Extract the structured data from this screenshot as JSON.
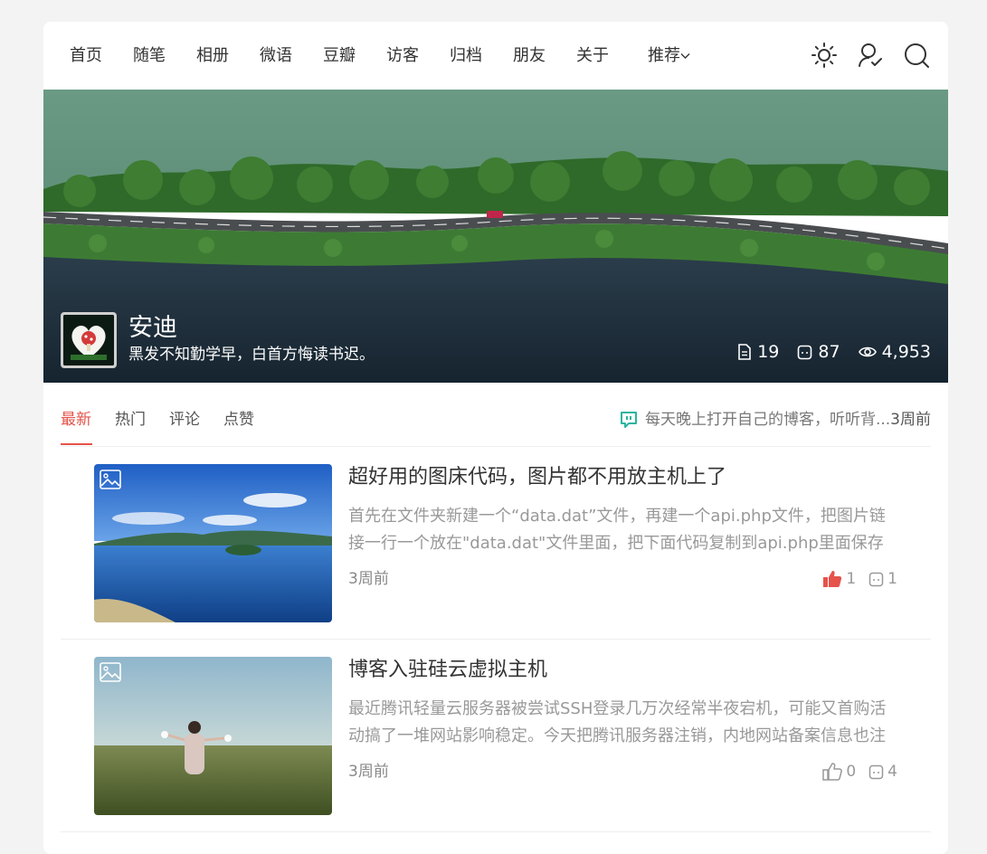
{
  "nav": {
    "items": [
      "首页",
      "随笔",
      "相册",
      "微语",
      "豆瓣",
      "访客",
      "归档",
      "朋友",
      "关于"
    ],
    "recommend_label": "推荐",
    "icons": [
      "sun-icon",
      "user-icon",
      "search-icon"
    ]
  },
  "hero": {
    "site_name": "安迪",
    "motto": "黑发不知勤学早，白首方悔读书迟。",
    "stats": {
      "posts": "19",
      "comments": "87",
      "views": "4,953"
    }
  },
  "tabs": {
    "items": [
      "最新",
      "热门",
      "评论",
      "点赞"
    ],
    "active": "最新",
    "notice_text": "每天晚上打开自己的博客，听听背...",
    "notice_time": "3周前"
  },
  "posts": [
    {
      "title": "超好用的图床代码，图片都不用放主机上了",
      "excerpt": "首先在文件夹新建一个“data.dat”文件，再建一个api.php文件，把图片链接一行一个放在\"data.dat\"文件里面，把下面代码复制到api.php里面保存",
      "time": "3周前",
      "likes": "1",
      "liked": true,
      "comments": "1"
    },
    {
      "title": "博客入驻硅云虚拟主机",
      "excerpt": "最近腾讯轻量云服务器被尝试SSH登录几万次经常半夜宕机，可能又首购活动搞了一堆网站影响稳定。今天把腾讯服务器注销，内地网站备案信息也注销了",
      "time": "3周前",
      "likes": "0",
      "liked": false,
      "comments": "4"
    }
  ],
  "colors": {
    "accent": "#e5534b",
    "notice_icon": "#2ab5a0"
  }
}
